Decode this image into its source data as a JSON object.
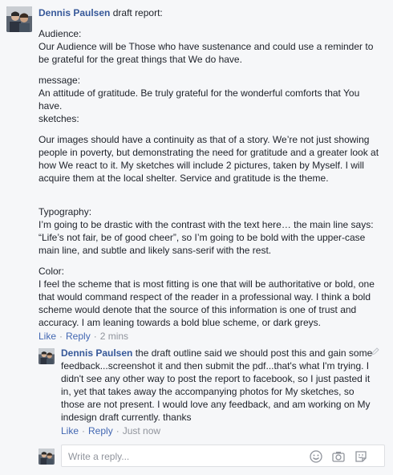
{
  "post": {
    "author": "Dennis Paulsen",
    "action": "draft report:",
    "audience_heading": "Audience:",
    "audience_text": "Our Audience will be Those who have sustenance and could use a reminder to be grateful for the great things that We do have.",
    "message_heading": "message:",
    "message_text": "An attitude of gratitude. Be truly grateful for the wonderful comforts that You have.",
    "sketches_heading": "sketches:",
    "sketches_text": "Our images should have a continuity as that of a story. We’re not just showing people in poverty, but demonstrating the need for gratitude and a greater look at how We react to it. My sketches will include 2 pictures, taken by Myself. I will acquire them at the local shelter. Service and gratitude is the theme.",
    "typography_heading": "Typography:",
    "typography_text": "I’m going to be drastic with the contrast with the text here… the main line says: “Life’s not fair, be of good cheer”, so I’m going to be bold with the upper-case main line, and subtle and likely sans-serif with the rest.",
    "color_heading": "Color:",
    "color_text": "I feel the scheme that is most fitting is one that will be authoritative or bold, one that would command respect of the reader in a professional way. I think a bold scheme would denote that the source of this information is one of trust and accuracy. I am leaning towards a bold blue scheme, or dark greys.",
    "like_label": "Like",
    "reply_label": "Reply",
    "time": "2 mins"
  },
  "reply": {
    "author": "Dennis Paulsen",
    "text": "the draft outline said we should post this and gain some feedback...screenshot it and then submit the pdf...that's what I'm trying. I didn't see any other way to post the report to facebook, so I just pasted it in, yet that takes away the accompanying photos for My sketches, so those are not present. I would love any feedback, and am working on My indesign draft currently. thanks",
    "like_label": "Like",
    "reply_label": "Reply",
    "time": "Just now"
  },
  "composer": {
    "placeholder": "Write a reply...",
    "icons": [
      "emoji-icon",
      "camera-icon",
      "sticker-icon"
    ]
  },
  "colors": {
    "link": "#4267b2",
    "name": "#365899",
    "meta": "#90949c",
    "background": "#f6f7f9"
  }
}
